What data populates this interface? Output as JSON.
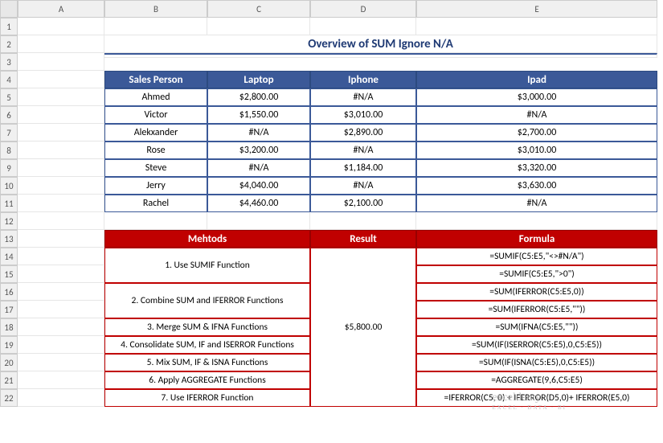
{
  "columns": [
    "A",
    "B",
    "C",
    "D",
    "E"
  ],
  "rows": [
    "1",
    "2",
    "3",
    "4",
    "5",
    "6",
    "7",
    "8",
    "9",
    "10",
    "11",
    "12",
    "13",
    "14",
    "15",
    "16",
    "17",
    "18",
    "19",
    "20",
    "21",
    "22"
  ],
  "title": "Overview of SUM Ignore N/A",
  "salesTable": {
    "headers": [
      "Sales Person",
      "Laptop",
      "Iphone",
      "Ipad"
    ],
    "rows": [
      [
        "Ahmed",
        "$2,800.00",
        "#N/A",
        "$3,000.00"
      ],
      [
        "Victor",
        "$1,550.00",
        "$3,010.00",
        "#N/A"
      ],
      [
        "Alekxander",
        "#N/A",
        "$2,890.00",
        "$2,700.00"
      ],
      [
        "Rose",
        "$3,200.00",
        "#N/A",
        "$3,010.00"
      ],
      [
        "Steve",
        "#N/A",
        "$1,184.00",
        "$3,320.00"
      ],
      [
        "Jerry",
        "$4,040.00",
        "#N/A",
        "$3,630.00"
      ],
      [
        "Rachel",
        "$4,460.00",
        "$2,100.00",
        "#N/A"
      ]
    ]
  },
  "methodsTable": {
    "headers": [
      "Mehtods",
      "Result",
      "Formula"
    ],
    "result": "$5,800.00",
    "rows": [
      {
        "method": "1. Use SUMIF Function",
        "formulas": [
          "=SUMIF(C5:E5,\"<>#N/A\")",
          "=SUMIF(C5:E5,\">0\")"
        ]
      },
      {
        "method": "2. Combine SUM and IFERROR Functions",
        "formulas": [
          "=SUM(IFERROR(C5:E5,0))",
          "=SUM(IFERROR(C5:E5,\"\"))"
        ]
      },
      {
        "method": "3. Merge SUM & IFNA Functions",
        "formulas": [
          "=SUM(IFNA(C5:E5,\"\"))"
        ]
      },
      {
        "method": "4. Consolidate SUM, IF and ISERROR Functions",
        "formulas": [
          "=SUM(IF(ISERROR(C5:E5),0,C5:E5))"
        ]
      },
      {
        "method": "5. Mix SUM, IF & ISNA Functions",
        "formulas": [
          "=SUM(IF(ISNA(C5:E5),0,C5:E5))"
        ]
      },
      {
        "method": "6. Apply AGGREGATE Functions",
        "formulas": [
          "=AGGREGATE(9,6,C5:E5)"
        ]
      },
      {
        "method": "7. Use IFERROR Function",
        "formulas": [
          "=IFERROR(C5, 0) + IFERROR(D5,0)+ IFERROR(E5,0)"
        ]
      }
    ]
  },
  "watermark": {
    "main": "exceldemy",
    "sub": "EXCEL · DATA · BI"
  }
}
